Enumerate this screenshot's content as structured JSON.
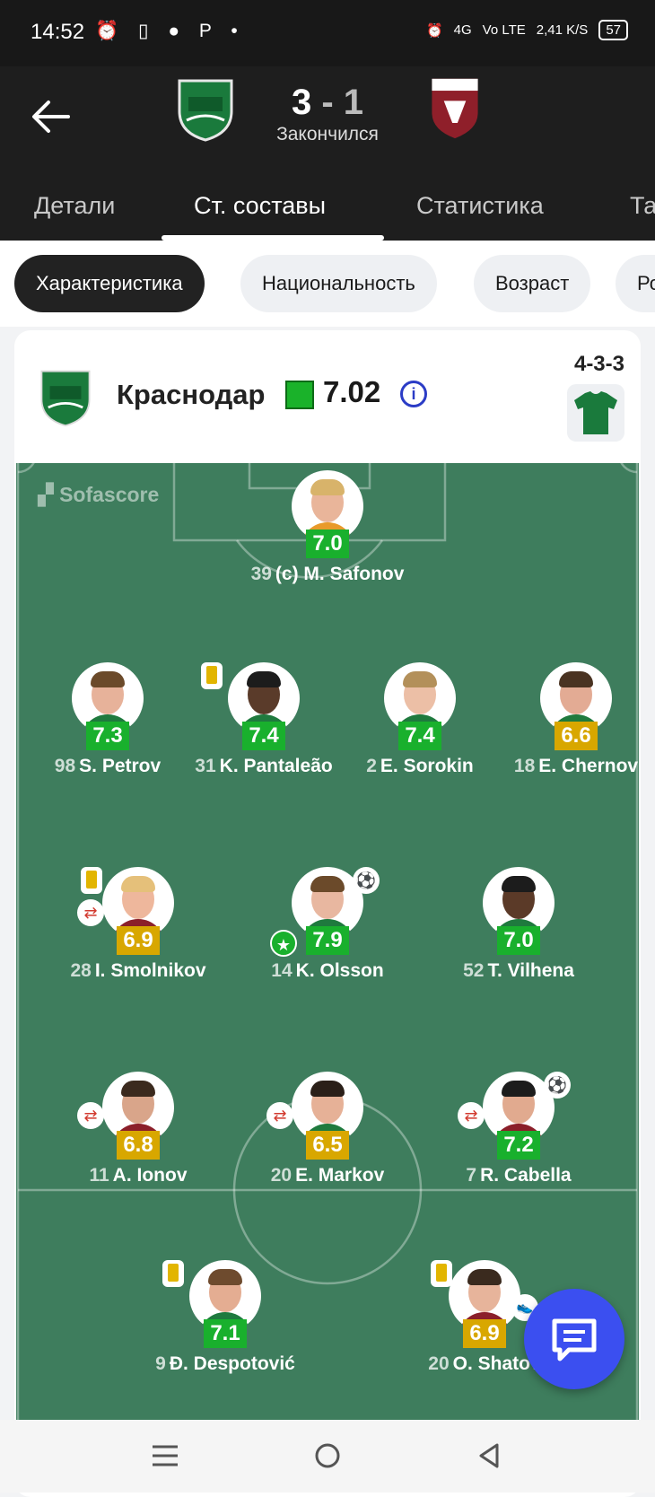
{
  "status_bar": {
    "time": "14:52",
    "signal_text": "4G",
    "volte": "Vo LTE",
    "speed": "2,41 K/S",
    "battery": "57"
  },
  "match": {
    "home_score": "3",
    "separator": "-",
    "away_score": "1",
    "status": "Закончился"
  },
  "tabs": [
    "Детали",
    "Ст. составы",
    "Статистика",
    "Та"
  ],
  "active_tab": 1,
  "chips": [
    "Характеристика",
    "Национальность",
    "Возраст",
    "Ро"
  ],
  "active_chip": 0,
  "team": {
    "name": "Краснодар",
    "rating": "7.02",
    "formation": "4-3-3",
    "watermark": "Sofascore"
  },
  "players": [
    {
      "number": "39",
      "name": "(c) M. Safonov",
      "rating": "7.0",
      "color": "g"
    },
    {
      "number": "98",
      "name": "S. Petrov",
      "rating": "7.3",
      "color": "g"
    },
    {
      "number": "31",
      "name": "K. Pantaleão",
      "rating": "7.4",
      "color": "g"
    },
    {
      "number": "2",
      "name": "E. Sorokin",
      "rating": "7.4",
      "color": "g"
    },
    {
      "number": "18",
      "name": "E. Chernov",
      "rating": "6.6",
      "color": "y"
    },
    {
      "number": "28",
      "name": "I. Smolnikov",
      "rating": "6.9",
      "color": "y"
    },
    {
      "number": "14",
      "name": "K. Olsson",
      "rating": "7.9",
      "color": "g"
    },
    {
      "number": "52",
      "name": "T. Vilhena",
      "rating": "7.0",
      "color": "g"
    },
    {
      "number": "11",
      "name": "A. Ionov",
      "rating": "6.8",
      "color": "y"
    },
    {
      "number": "20",
      "name": "E. Markov",
      "rating": "6.5",
      "color": "y"
    },
    {
      "number": "7",
      "name": "R. Cabella",
      "rating": "7.2",
      "color": "g"
    },
    {
      "number": "9",
      "name": "Đ. Despotović",
      "rating": "7.1",
      "color": "g"
    },
    {
      "number": "20",
      "name": "O. Shatov",
      "rating": "6.9",
      "color": "y"
    }
  ],
  "colors": {
    "pitch": "#3e7d5d",
    "rating_green": "#19b02d",
    "rating_yellow": "#d8a700",
    "fab": "#3b4ff0",
    "team_green": "#1a7a3c"
  }
}
